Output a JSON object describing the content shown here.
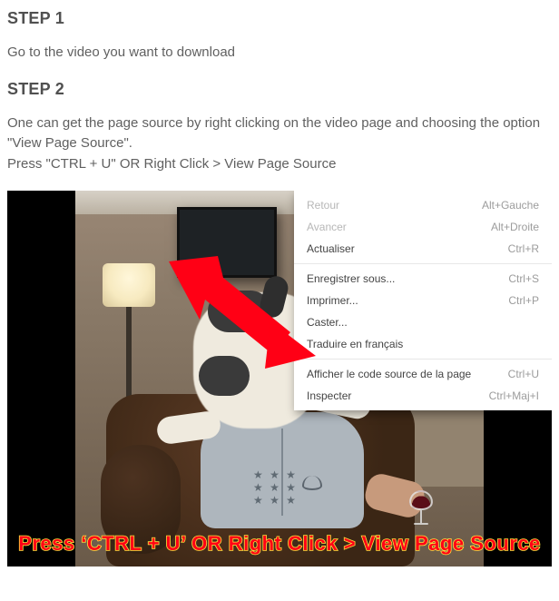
{
  "step1": {
    "heading": "STEP 1",
    "body": "Go to the video you want to download"
  },
  "step2": {
    "heading": "STEP 2",
    "body_line1": "One can get the page source by right clicking on the video page and choosing the option \"View Page Source\".",
    "body_line2": "Press \"CTRL + U\" OR Right Click > View Page Source"
  },
  "context_menu": {
    "items": [
      {
        "label": "Retour",
        "shortcut": "Alt+Gauche",
        "disabled": true
      },
      {
        "label": "Avancer",
        "shortcut": "Alt+Droite",
        "disabled": true
      },
      {
        "label": "Actualiser",
        "shortcut": "Ctrl+R",
        "disabled": false
      },
      {
        "separator": true
      },
      {
        "label": "Enregistrer sous...",
        "shortcut": "Ctrl+S",
        "disabled": false
      },
      {
        "label": "Imprimer...",
        "shortcut": "Ctrl+P",
        "disabled": false
      },
      {
        "label": "Caster...",
        "shortcut": "",
        "disabled": false
      },
      {
        "label": "Traduire en français",
        "shortcut": "",
        "disabled": false
      },
      {
        "separator": true
      },
      {
        "label": "Afficher le code source de la page",
        "shortcut": "Ctrl+U",
        "disabled": false
      },
      {
        "label": "Inspecter",
        "shortcut": "Ctrl+Maj+I",
        "disabled": false
      }
    ]
  },
  "caption": "Press ‘CTRL + U’ OR Right Click > View Page Source",
  "colors": {
    "arrow": "#ff0015",
    "caption_fill": "#ff0016",
    "caption_stroke": "#ffe23c"
  }
}
